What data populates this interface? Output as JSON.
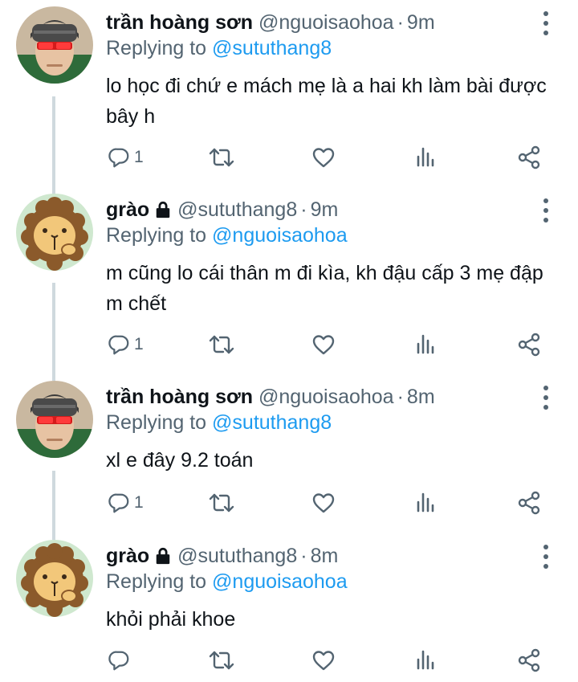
{
  "colors": {
    "link": "#1d9bf0",
    "muted": "#536471",
    "text": "#0f1419"
  },
  "tweets": [
    {
      "name": "trần hoàng sơn",
      "handle": "@nguoisaohoa",
      "time": "9m",
      "separator": "·",
      "replying_label": "Replying to",
      "replying_to": "@sututhang8",
      "text": "lo học đi chứ e mách mẹ là a hai kh làm bài được bây h",
      "reply_count": "1",
      "locked": false,
      "avatar": "person-avatar"
    },
    {
      "name": "grào",
      "handle": "@sututhang8",
      "time": "9m",
      "separator": "·",
      "replying_label": "Replying to",
      "replying_to": "@nguoisaohoa",
      "text": "m cũng lo cái thân m đi kìa, kh đậu cấp 3 mẹ đập m chết",
      "reply_count": "1",
      "locked": true,
      "avatar": "lion-avatar"
    },
    {
      "name": "trần hoàng sơn",
      "handle": "@nguoisaohoa",
      "time": "8m",
      "separator": "·",
      "replying_label": "Replying to",
      "replying_to": "@sututhang8",
      "text": "xl e đây 9.2 toán",
      "reply_count": "1",
      "locked": false,
      "avatar": "person-avatar"
    },
    {
      "name": "grào",
      "handle": "@sututhang8",
      "time": "8m",
      "separator": "·",
      "replying_label": "Replying to",
      "replying_to": "@nguoisaohoa",
      "text": "khỏi phải khoe",
      "reply_count": "",
      "locked": true,
      "avatar": "lion-avatar"
    }
  ],
  "action_icons": [
    "reply-icon",
    "retweet-icon",
    "like-icon",
    "analytics-icon",
    "share-icon"
  ]
}
